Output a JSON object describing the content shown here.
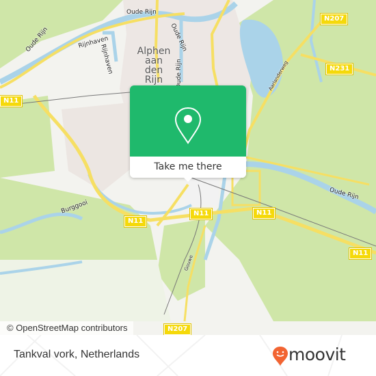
{
  "map": {
    "city_label": [
      "Alphen",
      "aan",
      "den",
      "Rijn"
    ],
    "water_labels": [
      {
        "id": "oude-rijn-west",
        "text": "Oude Rijn"
      },
      {
        "id": "oude-rijn-top",
        "text": "Oude Rijn"
      },
      {
        "id": "oude-rijn-north",
        "text": "Oude Rijn"
      },
      {
        "id": "oude-rijn-vertical",
        "text": "Oude Rijn"
      },
      {
        "id": "oude-rijn-east",
        "text": "Oude Rijn"
      },
      {
        "id": "rijnhaven-h",
        "text": "Rijnhaven"
      },
      {
        "id": "rijnhaven-v",
        "text": "Rijnhaven"
      },
      {
        "id": "burggooi",
        "text": "Burggooi"
      }
    ],
    "street_labels": [
      {
        "id": "aarlanderweg",
        "text": "Aarlanderweg"
      },
      {
        "id": "gouwe",
        "text": "Gouwe"
      }
    ],
    "road_shields": [
      {
        "id": "n207-top",
        "text": "N207"
      },
      {
        "id": "n231",
        "text": "N231"
      },
      {
        "id": "n11-west",
        "text": "N11"
      },
      {
        "id": "n11-mid-left",
        "text": "N11"
      },
      {
        "id": "n11-center",
        "text": "N11"
      },
      {
        "id": "n11-center-right",
        "text": "N11"
      },
      {
        "id": "n11-east",
        "text": "N11"
      },
      {
        "id": "n207-bottom",
        "text": "N207"
      }
    ],
    "attribution": "© OpenStreetMap contributors"
  },
  "popup": {
    "icon": "location-pin-icon",
    "button_label": "Take me there",
    "color": "#1fb96c"
  },
  "footer": {
    "location_title": "Tankval vork, Netherlands",
    "brand": "moovit",
    "brand_icon": "moovit-pin-icon",
    "brand_color": "#f26432"
  }
}
